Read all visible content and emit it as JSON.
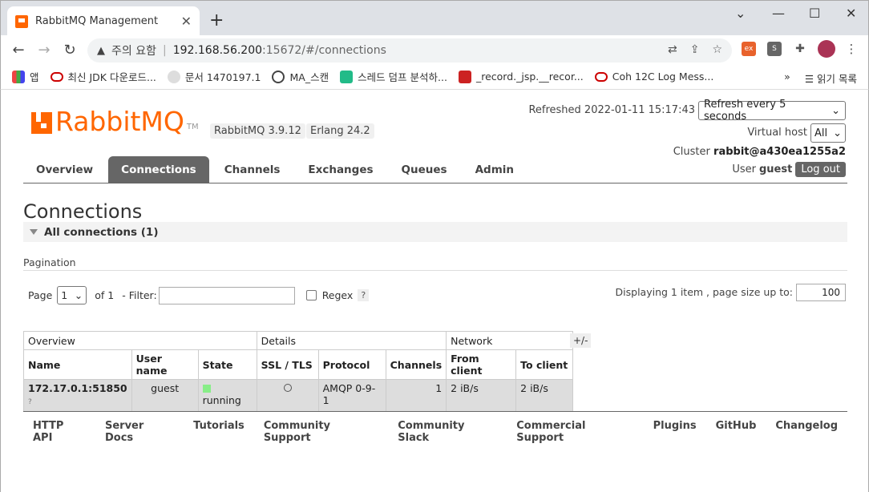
{
  "browser": {
    "tab_title": "RabbitMQ Management",
    "tab_close": "✕",
    "new_tab": "+",
    "window": {
      "minimize": "⌄",
      "restore": "—",
      "maximize": "☐",
      "close": "✕"
    },
    "security_warning": "주의 요함",
    "url_host": "192.168.56.200",
    "url_path": ":15672/#/connections",
    "bookmarks": [
      "앱",
      "최신 JDK 다운로드...",
      "문서 1470197.1",
      "MA_스캔",
      "스레드 덤프 분석하...",
      "_record._jsp.__recor...",
      "Coh 12C Log Mess..."
    ],
    "bookmarks_more": "»",
    "reading_list": "읽기 목록"
  },
  "header": {
    "logo_text": "RabbitMQ",
    "logo_tm": "TM",
    "version_badge": "RabbitMQ 3.9.12",
    "erlang_badge": "Erlang 24.2",
    "refreshed": "Refreshed 2022-01-11 15:17:43",
    "refresh_select": "Refresh every 5 seconds",
    "virtual_host_label": "Virtual host",
    "virtual_host_value": "All",
    "cluster_label": "Cluster",
    "cluster_value": "rabbit@a430ea1255a2",
    "user_label": "User",
    "user_value": "guest",
    "logout_label": "Log out"
  },
  "nav": [
    "Overview",
    "Connections",
    "Channels",
    "Exchanges",
    "Queues",
    "Admin"
  ],
  "page": {
    "title": "Connections",
    "section": "All connections (1)",
    "pagination_label": "Pagination",
    "page_label": "Page",
    "page_value": "1",
    "of_label": "of 1",
    "filter_label": "- Filter:",
    "regex_label": "Regex",
    "help_mark": "?",
    "displaying": "Displaying 1 item , page size up to:",
    "page_size": "100",
    "plus_minus": "+/-"
  },
  "table": {
    "groups": [
      "Overview",
      "Details",
      "Network"
    ],
    "headers": [
      "Name",
      "User name",
      "State",
      "SSL / TLS",
      "Protocol",
      "Channels",
      "From client",
      "To client"
    ],
    "row": {
      "name": "172.17.0.1:51850",
      "name_sub": "?",
      "user": "guest",
      "state": "running",
      "protocol": "AMQP 0-9-1",
      "channels": "1",
      "from_client": "2 iB/s",
      "to_client": "2 iB/s"
    }
  },
  "footer": [
    "HTTP API",
    "Server Docs",
    "Tutorials",
    "Community Support",
    "Community Slack",
    "Commercial Support",
    "Plugins",
    "GitHub",
    "Changelog"
  ],
  "colors": {
    "brand": "#ff6600",
    "nav_active": "#666666",
    "running": "#88ee88"
  }
}
